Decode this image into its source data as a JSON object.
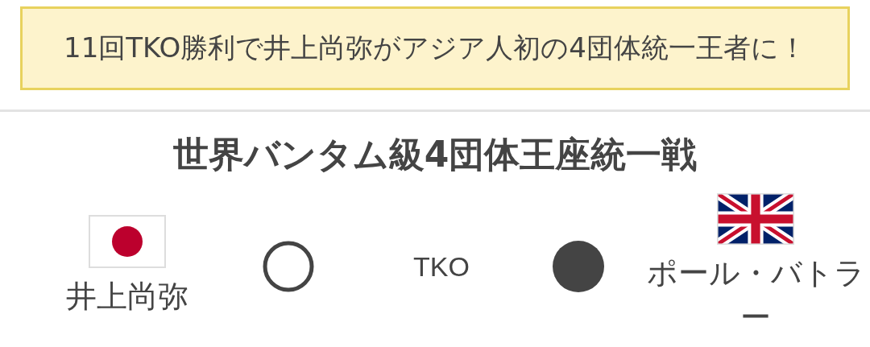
{
  "headline": "11回TKO勝利で井上尚弥がアジア人初の4団体統一王者に！",
  "bout": {
    "title": "世界バンタム級4団体王座統一戦",
    "method": "TKO",
    "fighters": [
      {
        "name": "井上尚弥",
        "kind": "winner",
        "flag": {
          "kind": "japan"
        }
      },
      {
        "name": "ポール・バトラー",
        "kind": "loser",
        "flag": {
          "kind": "uk"
        }
      }
    ]
  }
}
